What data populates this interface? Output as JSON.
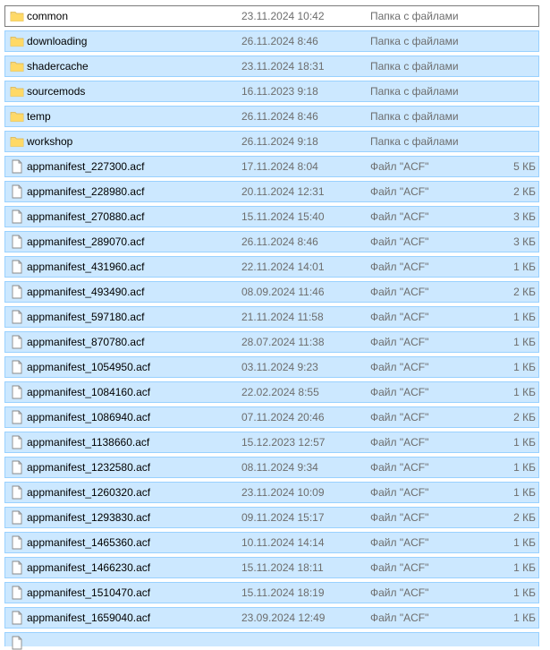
{
  "icons": {
    "folder": "folder-icon",
    "file": "file-icon"
  },
  "colors": {
    "selection_background": "#cce8ff",
    "selection_border": "#99d1ff",
    "folder_yellow": "#f8d775",
    "secondary_text": "#6d6d6d"
  },
  "rows": [
    {
      "kind": "folder",
      "name": "common",
      "date": "23.11.2024 10:42",
      "type": "Папка с файлами",
      "size": "",
      "selected": false
    },
    {
      "kind": "folder",
      "name": "downloading",
      "date": "26.11.2024 8:46",
      "type": "Папка с файлами",
      "size": "",
      "selected": true
    },
    {
      "kind": "folder",
      "name": "shadercache",
      "date": "23.11.2024 18:31",
      "type": "Папка с файлами",
      "size": "",
      "selected": true
    },
    {
      "kind": "folder",
      "name": "sourcemods",
      "date": "16.11.2023 9:18",
      "type": "Папка с файлами",
      "size": "",
      "selected": true
    },
    {
      "kind": "folder",
      "name": "temp",
      "date": "26.11.2024 8:46",
      "type": "Папка с файлами",
      "size": "",
      "selected": true
    },
    {
      "kind": "folder",
      "name": "workshop",
      "date": "26.11.2024 9:18",
      "type": "Папка с файлами",
      "size": "",
      "selected": true
    },
    {
      "kind": "file",
      "name": "appmanifest_227300.acf",
      "date": "17.11.2024 8:04",
      "type": "Файл \"ACF\"",
      "size": "5 КБ",
      "selected": true
    },
    {
      "kind": "file",
      "name": "appmanifest_228980.acf",
      "date": "20.11.2024 12:31",
      "type": "Файл \"ACF\"",
      "size": "2 КБ",
      "selected": true
    },
    {
      "kind": "file",
      "name": "appmanifest_270880.acf",
      "date": "15.11.2024 15:40",
      "type": "Файл \"ACF\"",
      "size": "3 КБ",
      "selected": true
    },
    {
      "kind": "file",
      "name": "appmanifest_289070.acf",
      "date": "26.11.2024 8:46",
      "type": "Файл \"ACF\"",
      "size": "3 КБ",
      "selected": true
    },
    {
      "kind": "file",
      "name": "appmanifest_431960.acf",
      "date": "22.11.2024 14:01",
      "type": "Файл \"ACF\"",
      "size": "1 КБ",
      "selected": true
    },
    {
      "kind": "file",
      "name": "appmanifest_493490.acf",
      "date": "08.09.2024 11:46",
      "type": "Файл \"ACF\"",
      "size": "2 КБ",
      "selected": true
    },
    {
      "kind": "file",
      "name": "appmanifest_597180.acf",
      "date": "21.11.2024 11:58",
      "type": "Файл \"ACF\"",
      "size": "1 КБ",
      "selected": true
    },
    {
      "kind": "file",
      "name": "appmanifest_870780.acf",
      "date": "28.07.2024 11:38",
      "type": "Файл \"ACF\"",
      "size": "1 КБ",
      "selected": true
    },
    {
      "kind": "file",
      "name": "appmanifest_1054950.acf",
      "date": "03.11.2024 9:23",
      "type": "Файл \"ACF\"",
      "size": "1 КБ",
      "selected": true
    },
    {
      "kind": "file",
      "name": "appmanifest_1084160.acf",
      "date": "22.02.2024 8:55",
      "type": "Файл \"ACF\"",
      "size": "1 КБ",
      "selected": true
    },
    {
      "kind": "file",
      "name": "appmanifest_1086940.acf",
      "date": "07.11.2024 20:46",
      "type": "Файл \"ACF\"",
      "size": "2 КБ",
      "selected": true
    },
    {
      "kind": "file",
      "name": "appmanifest_1138660.acf",
      "date": "15.12.2023 12:57",
      "type": "Файл \"ACF\"",
      "size": "1 КБ",
      "selected": true
    },
    {
      "kind": "file",
      "name": "appmanifest_1232580.acf",
      "date": "08.11.2024 9:34",
      "type": "Файл \"ACF\"",
      "size": "1 КБ",
      "selected": true
    },
    {
      "kind": "file",
      "name": "appmanifest_1260320.acf",
      "date": "23.11.2024 10:09",
      "type": "Файл \"ACF\"",
      "size": "1 КБ",
      "selected": true
    },
    {
      "kind": "file",
      "name": "appmanifest_1293830.acf",
      "date": "09.11.2024 15:17",
      "type": "Файл \"ACF\"",
      "size": "2 КБ",
      "selected": true
    },
    {
      "kind": "file",
      "name": "appmanifest_1465360.acf",
      "date": "10.11.2024 14:14",
      "type": "Файл \"ACF\"",
      "size": "1 КБ",
      "selected": true
    },
    {
      "kind": "file",
      "name": "appmanifest_1466230.acf",
      "date": "15.11.2024 18:11",
      "type": "Файл \"ACF\"",
      "size": "1 КБ",
      "selected": true
    },
    {
      "kind": "file",
      "name": "appmanifest_1510470.acf",
      "date": "15.11.2024 18:19",
      "type": "Файл \"ACF\"",
      "size": "1 КБ",
      "selected": true
    },
    {
      "kind": "file",
      "name": "appmanifest_1659040.acf",
      "date": "23.09.2024 12:49",
      "type": "Файл \"ACF\"",
      "size": "1 КБ",
      "selected": true
    }
  ]
}
